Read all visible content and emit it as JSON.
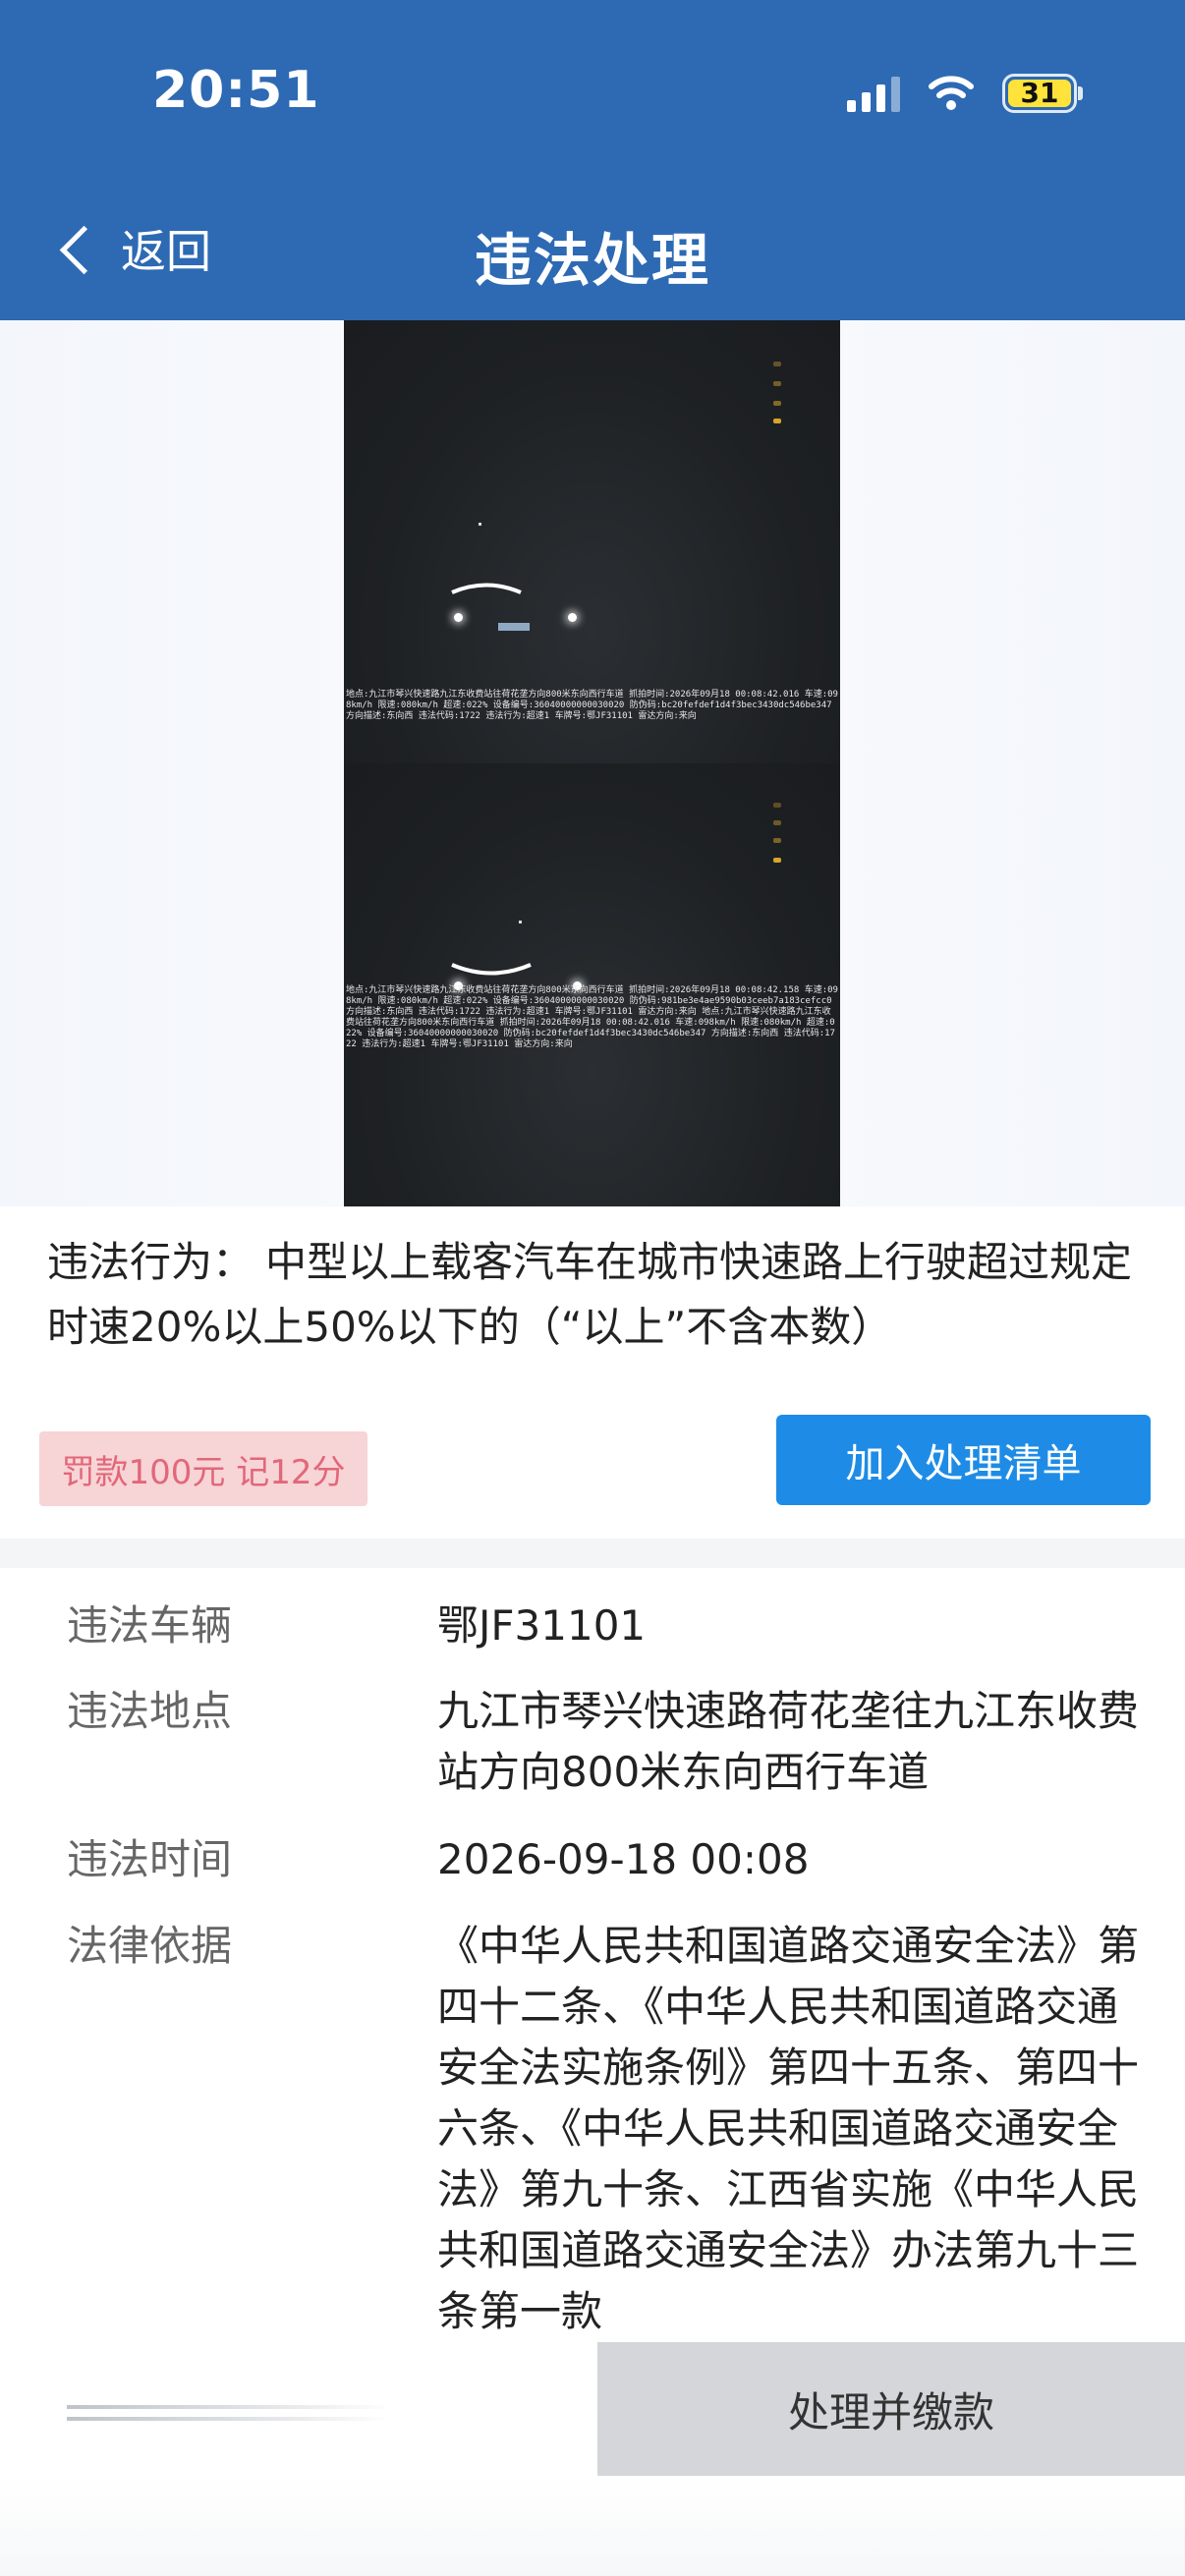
{
  "status_bar": {
    "time": "20:51",
    "battery": "31"
  },
  "header": {
    "back_label": "返回",
    "title": "违法处理"
  },
  "photos": {
    "frame1_caption": "地点:九江市琴兴快速路九江东收费站往荷花垄方向800米东向西行车道 抓拍时间:2026年09月18 00:08:42.016 车速:098km/h 限速:080km/h 超速:022% 设备编号:36040000000030020 防伪码:bc20fefdef1d4f3bec3430dc546be347 方向描述:东向西 违法代码:1722 违法行为:超速1 车牌号:鄂JF31101 雷达方向:来向",
    "frame2_caption": "地点:九江市琴兴快速路九江东收费站往荷花垄方向800米东向西行车道 抓拍时间:2026年09月18 00:08:42.158 车速:098km/h 限速:080km/h 超速:022% 设备编号:36040000000030020 防伪码:981be3e4ae9590b03ceeb7a183cefcc0 方向描述:东向西 违法代码:1722 违法行为:超速1 车牌号:鄂JF31101 雷达方向:来向 地点:九江市琴兴快速路九江东收费站往荷花垄方向800米东向西行车道 抓拍时间:2026年09月18 00:08:42.016 车速:098km/h 限速:080km/h 超速:022% 设备编号:36040000000030020 防伪码:bc20fefdef1d4f3bec3430dc546be347 方向描述:东向西 违法代码:1722 违法行为:超速1 车牌号:鄂JF31101 雷达方向:来向"
  },
  "violation": {
    "label": "违法行为：",
    "text": "中型以上载客汽车在城市快速路上行驶超过规定时速20%以上50%以下的（“以上”不含本数）"
  },
  "penalty": {
    "badge": "罚款100元 记12分",
    "add_button": "加入处理清单"
  },
  "details": [
    {
      "key": "违法车辆",
      "value": "鄂JF31101"
    },
    {
      "key": "违法地点",
      "value": "九江市琴兴快速路荷花垄往九江东收费站方向800米东向西行车道"
    },
    {
      "key": "违法时间",
      "value": "2026-09-18 00:08"
    },
    {
      "key": "法律依据",
      "value": "《中华人民共和国道路交通安全法》第四十二条、《中华人民共和国道路交通安全法实施条例》第四十五条、第四十六条、《中华人民共和国道路交通安全法》第九十条、江西省实施《中华人民共和国道路交通安全法》办法第九十三条第一款"
    }
  ],
  "footer": {
    "pay_button": "处理并缴款"
  },
  "colors": {
    "header": "#2d6ab3",
    "primary_button": "#1e8ce6",
    "badge_bg": "#f7d4d6",
    "badge_text": "#e2677a"
  }
}
